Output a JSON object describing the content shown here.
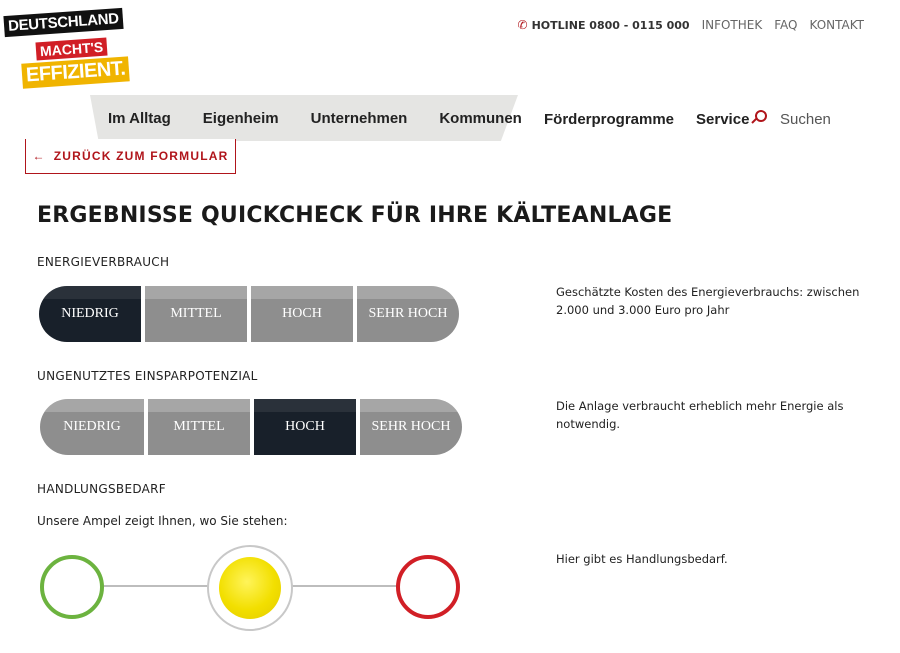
{
  "logo": {
    "line1": "DEUTSCHLAND",
    "line2": "MACHT'S",
    "line3": "EFFIZIENT."
  },
  "topbar": {
    "hotline": "HOTLINE 0800 - 0115 000",
    "links": [
      "INFOTHEK",
      "FAQ",
      "KONTAKT"
    ]
  },
  "nav": {
    "primary": [
      "Im Alltag",
      "Eigenheim",
      "Unternehmen",
      "Kommunen"
    ],
    "secondary": [
      "Förderprogramme",
      "Service"
    ],
    "search_label": "Suchen"
  },
  "back_button": {
    "arrow": "←",
    "label": "ZURÜCK ZUM FORMULAR"
  },
  "page_title": "ERGEBNISSE QUICKCHECK FÜR IHRE KÄLTEANLAGE",
  "energy": {
    "label": "ENERGIEVERBRAUCH",
    "levels": [
      "NIEDRIG",
      "MITTEL",
      "HOCH",
      "SEHR HOCH"
    ],
    "selected": "NIEDRIG",
    "description": "Geschätzte Kosten des Energieverbrauchs: zwischen 2.000 und 3.000 Euro pro Jahr"
  },
  "savings": {
    "label": "UNGENUTZTES EINSPARPOTENZIAL",
    "levels": [
      "NIEDRIG",
      "MITTEL",
      "HOCH",
      "SEHR HOCH"
    ],
    "selected": "HOCH",
    "description": "Die Anlage verbraucht erheblich mehr Energie als notwendig."
  },
  "action": {
    "label": "HANDLUNGSBEDARF",
    "hint": "Unsere Ampel zeigt Ihnen, wo Sie stehen:",
    "selected": "yellow",
    "description": "Hier gibt es Handlungsbedarf."
  },
  "colors": {
    "brand_red": "#b0151b",
    "segment_inactive": "#8e8e8e",
    "segment_active": "#18202a",
    "light_green": "#6cb33f",
    "light_yellow": "#f2df00",
    "light_red": "#d11f26"
  }
}
